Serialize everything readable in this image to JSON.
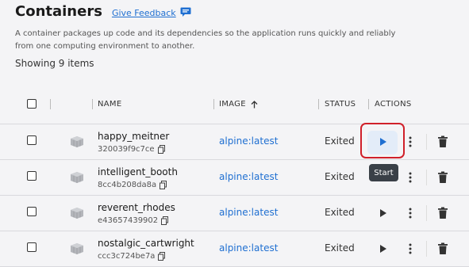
{
  "page": {
    "title": "Containers",
    "feedback_label": "Give Feedback",
    "description": "A container packages up code and its dependencies so the application runs quickly and reliably from one computing environment to another.",
    "count_text": "Showing 9 items"
  },
  "table": {
    "columns": {
      "name": "NAME",
      "image": "IMAGE",
      "image_sort_icon": "arrow-up-icon",
      "status": "STATUS",
      "actions": "ACTIONS"
    },
    "rows": [
      {
        "name": "happy_meitner",
        "id": "320039f9c7ce",
        "image": "alpine:latest",
        "status": "Exited"
      },
      {
        "name": "intelligent_booth",
        "id": "8cc4b208da8a",
        "image": "alpine:latest",
        "status": "Exited"
      },
      {
        "name": "reverent_rhodes",
        "id": "e43657439902",
        "image": "alpine:latest",
        "status": "Exited"
      },
      {
        "name": "nostalgic_cartwright",
        "id": "ccc3c724be7a",
        "image": "alpine:latest",
        "status": "Exited"
      }
    ]
  },
  "tooltip": {
    "text": "Start"
  },
  "colors": {
    "accent": "#1f6fd1",
    "highlight": "#d0202a",
    "tooltip_bg": "#3a4047"
  }
}
